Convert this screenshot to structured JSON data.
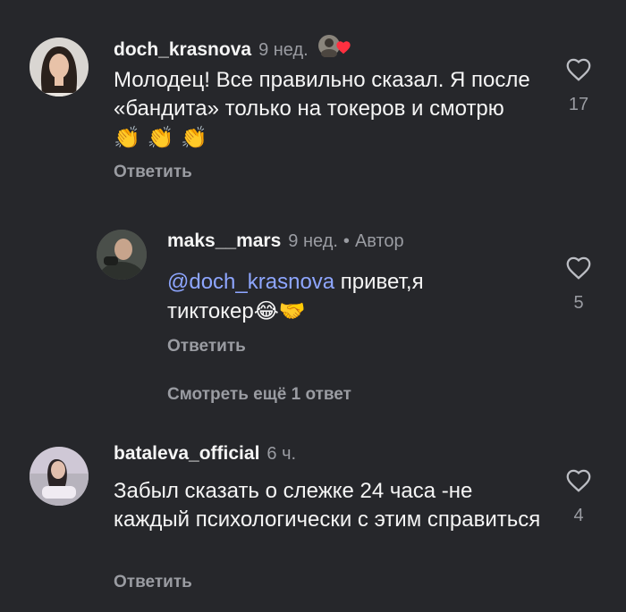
{
  "comments": [
    {
      "username": "doch_krasnova",
      "time": "9 нед.",
      "text": "Молодец! Все правильно сказал. Я после «бандита» только на токеров и смотрю",
      "emoji": "👏 👏 👏",
      "reply_label": "Ответить",
      "likes": "17"
    },
    {
      "username": "maks__mars",
      "time": "9 нед.",
      "author_label": "Автор",
      "mention": "@doch_krasnova",
      "text": " привет,я тиктокер",
      "emoji": "😂🤝",
      "reply_label": "Ответить",
      "likes": "5",
      "more_replies": "Смотреть ещё 1 ответ"
    },
    {
      "username": "bataleva_official",
      "time": "6 ч.",
      "text": "Забыл сказать о слежке 24 часа -не каждый психологически с этим справиться",
      "reply_label": "Ответить",
      "likes": "4"
    }
  ],
  "colors": {
    "background": "#26272b",
    "muted": "#9a9ca2",
    "mention": "#8ea6ff"
  },
  "icons": [
    "heart-outline-icon",
    "heart-filled-icon"
  ]
}
